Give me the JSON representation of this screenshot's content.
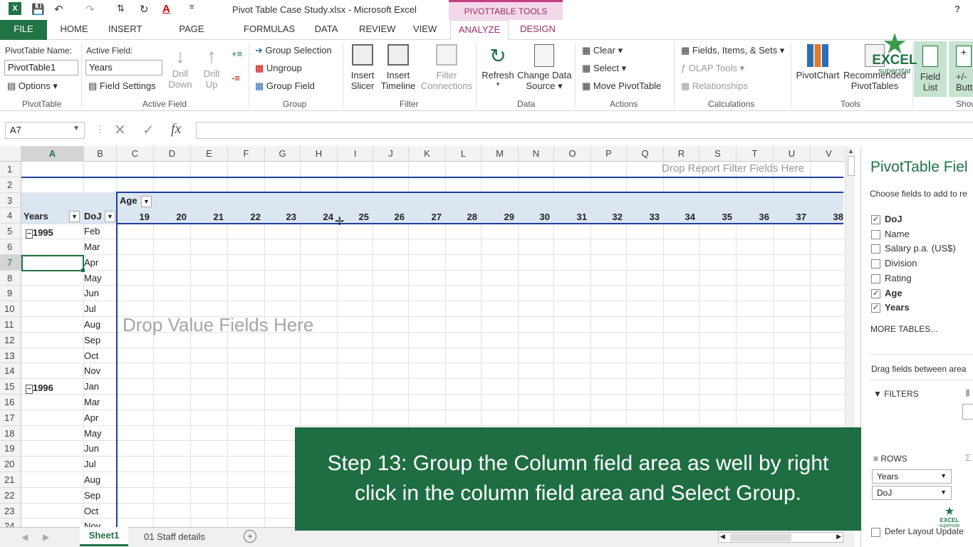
{
  "window": {
    "title": "Pivot Table Case Study.xlsx - Microsoft Excel",
    "context_title": "PIVOTTABLE TOOLS",
    "help": "?"
  },
  "tabs": [
    "FILE",
    "HOME",
    "INSERT",
    "PAGE LAYOUT",
    "FORMULAS",
    "DATA",
    "REVIEW",
    "VIEW",
    "ANALYZE",
    "DESIGN"
  ],
  "ribbon": {
    "pivottable": {
      "name_label": "PivotTable Name:",
      "name_value": "PivotTable1",
      "options": "Options",
      "group": "PivotTable"
    },
    "active_field": {
      "label": "Active Field:",
      "value": "Years",
      "settings": "Field Settings",
      "drill_down_1": "Drill",
      "drill_down_2": "Down",
      "drill_up_1": "Drill",
      "drill_up_2": "Up",
      "group": "Active Field"
    },
    "group": {
      "selection": "Group Selection",
      "ungroup": "Ungroup",
      "field": "Group Field",
      "group": "Group"
    },
    "filter": {
      "slicer_1": "Insert",
      "slicer_2": "Slicer",
      "timeline_1": "Insert",
      "timeline_2": "Timeline",
      "conn_1": "Filter",
      "conn_2": "Connections",
      "group": "Filter"
    },
    "data": {
      "refresh": "Refresh",
      "change_1": "Change Data",
      "change_2": "Source",
      "group": "Data"
    },
    "actions": {
      "clear": "Clear",
      "select": "Select",
      "move": "Move PivotTable",
      "group": "Actions"
    },
    "calculations": {
      "fields": "Fields, Items, & Sets",
      "olap": "OLAP Tools",
      "relationships": "Relationships",
      "group": "Calculations"
    },
    "tools": {
      "chart": "PivotChart",
      "recommended_1": "Recommended",
      "recommended_2": "PivotTables",
      "group": "Tools"
    },
    "show": {
      "field_list_1": "Field",
      "field_list_2": "List",
      "buttons_1": "+/-",
      "buttons_2": "Buttons",
      "group": "Show"
    }
  },
  "formula": {
    "cell": "A7",
    "fx": "fx"
  },
  "columns": [
    "A",
    "B",
    "C",
    "D",
    "E",
    "F",
    "G",
    "H",
    "I",
    "J",
    "K",
    "L",
    "M",
    "N",
    "O",
    "P",
    "Q",
    "R",
    "S",
    "T",
    "U",
    "V"
  ],
  "rows": [
    "1",
    "2",
    "3",
    "4",
    "5",
    "6",
    "7",
    "8",
    "9",
    "10",
    "11",
    "12",
    "13",
    "14",
    "15",
    "16",
    "17",
    "18",
    "19",
    "20",
    "21",
    "22",
    "23",
    "24"
  ],
  "pivot": {
    "report_filter_hint": "Drop Report Filter Fields Here",
    "value_hint": "Drop Value Fields Here",
    "col_field": "Age",
    "row_field_1": "Years",
    "row_field_2": "DoJ",
    "ages": [
      "19",
      "20",
      "21",
      "22",
      "23",
      "24",
      "25",
      "26",
      "27",
      "28",
      "29",
      "30",
      "31",
      "32",
      "33",
      "34",
      "35",
      "36",
      "37",
      "38"
    ],
    "year_1995": "1995",
    "year_1996": "1996",
    "months_1995": [
      "Feb",
      "Mar",
      "Apr",
      "May",
      "Jun",
      "Jul",
      "Aug",
      "Sep",
      "Oct",
      "Nov"
    ],
    "months_1996": [
      "Jan",
      "Mar",
      "Apr",
      "May",
      "Jun",
      "Jul",
      "Aug",
      "Sep",
      "Oct",
      "Nov"
    ]
  },
  "sheet_tabs": [
    "Sheet1",
    "01 Staff details"
  ],
  "panel": {
    "title": "PivotTable Fiel",
    "choose": "Choose fields to add to re",
    "fields": [
      {
        "name": "DoJ",
        "checked": true
      },
      {
        "name": "Name",
        "checked": false
      },
      {
        "name": "Salary p.a. (US$)",
        "checked": false
      },
      {
        "name": "Division",
        "checked": false
      },
      {
        "name": "Rating",
        "checked": false
      },
      {
        "name": "Age",
        "checked": true
      },
      {
        "name": "Years",
        "checked": true
      }
    ],
    "more_tables": "MORE TABLES...",
    "drag": "Drag fields between area",
    "filters": "FILTERS",
    "rows": "ROWS",
    "row_items": [
      "Years",
      "DoJ"
    ],
    "defer": "Defer Layout Update"
  },
  "overlay": {
    "line1": "Step 13: Group the Column field area as well by right",
    "line2": "click in the column field area and Select Group."
  },
  "logo": {
    "main": "EXCEL",
    "sub": "superstar",
    "small_1": "EXCEL",
    "small_2": "superstar"
  },
  "colors": {
    "excel_green": "#217346",
    "pivot_blue": "#1f3f9e",
    "overlay_green": "#1f6e43",
    "analyze_pink": "#9c2f66"
  }
}
